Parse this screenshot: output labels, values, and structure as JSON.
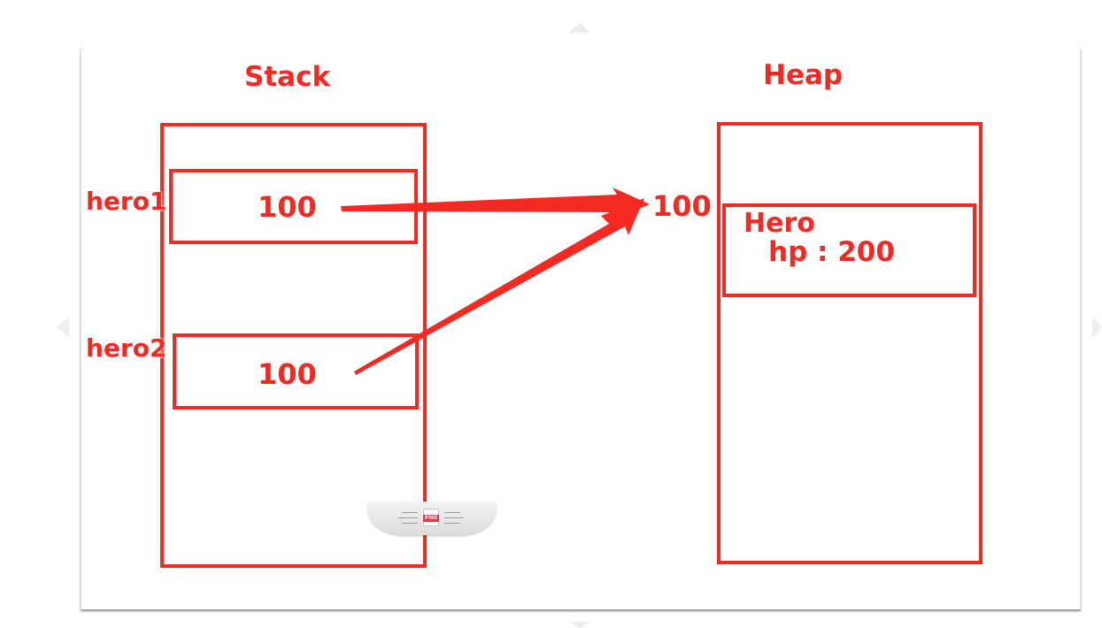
{
  "stack": {
    "title": "Stack",
    "slots": [
      {
        "name": "hero1",
        "value": "100"
      },
      {
        "name": "hero2",
        "value": "100"
      }
    ]
  },
  "heap": {
    "title": "Heap",
    "address": "100",
    "object": {
      "class_name": "Hero",
      "field": "hp : 200"
    }
  },
  "attachment": {
    "badge": "PNG"
  },
  "colors": {
    "accent": "#f42a22"
  }
}
